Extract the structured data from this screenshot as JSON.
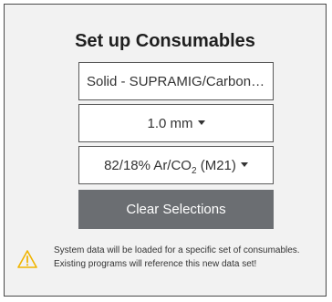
{
  "dialog": {
    "title": "Set up Consumables"
  },
  "fields": {
    "material": {
      "value": "Solid - SUPRAMIG/Carbon Steel"
    },
    "wire_diameter": {
      "value": "1.0 mm"
    },
    "gas": {
      "value_prefix": "82/18% Ar/CO",
      "value_subscript": "2",
      "value_suffix": " (M21)"
    }
  },
  "buttons": {
    "clear_label": "Clear Selections"
  },
  "notice": {
    "line1": "System data will be loaded for a specific set of consumables.",
    "line2": "Existing programs will reference this new data set!"
  },
  "colors": {
    "warning": "#f0b400",
    "button_bg": "#6b6e72",
    "panel_bg": "#f2f2f2"
  },
  "icons": {
    "warning": "warning-triangle-icon",
    "dropdown": "caret-down-icon"
  }
}
